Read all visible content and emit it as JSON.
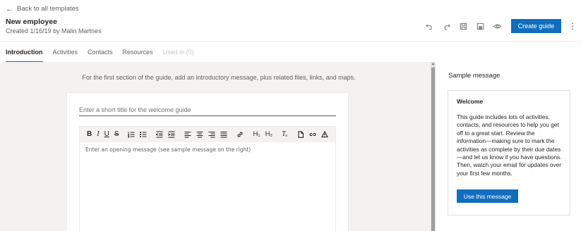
{
  "header": {
    "back_label": "Back to all templates",
    "title": "New employee",
    "subtitle": "Created 1/16/19 by Malin Martnes"
  },
  "toolbar": {
    "icons": [
      "undo-icon",
      "redo-icon",
      "save-icon",
      "save-as-icon",
      "preview-icon"
    ],
    "create_label": "Create guide",
    "more_icon": "more-vertical-icon"
  },
  "tabs": [
    {
      "label": "Introduction",
      "state": "active"
    },
    {
      "label": "Activities",
      "state": "normal"
    },
    {
      "label": "Contacts",
      "state": "normal"
    },
    {
      "label": "Resources",
      "state": "normal"
    },
    {
      "label": "Used in (0)",
      "state": "disabled"
    }
  ],
  "main": {
    "intro_text": "For the first section of the guide, add an introductory message, plus related files, links, and maps.",
    "title_placeholder": "Enter a short title for the welcome guide",
    "editor_placeholder": "Enter an opening message (see sample message on the right)",
    "format_buttons": {
      "bold": "B",
      "italic": "I",
      "underline": "U",
      "strike": "S",
      "h1": "H₁",
      "h2": "H₂",
      "clear": "Tₓ"
    }
  },
  "sample": {
    "heading": "Sample message",
    "title": "Welcome",
    "body": "This guide includes lots of activities, contacts, and resources to help you get off to a great start. Review the information—making sure to mark the activities as complete by their due dates—and let us know if you have questions. Then, watch your email for updates over your first few months.",
    "button_label": "Use this message"
  },
  "colors": {
    "accent": "#106ebe",
    "canvas": "#f3f2f1"
  }
}
